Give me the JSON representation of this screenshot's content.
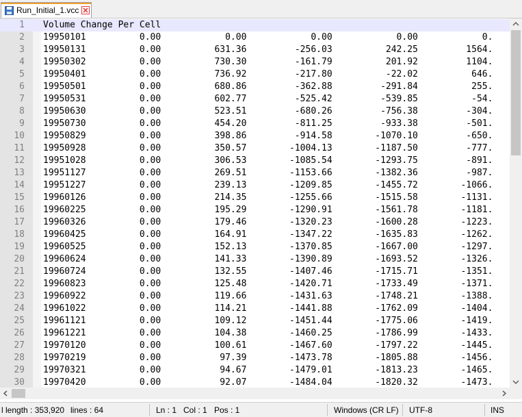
{
  "tab": {
    "title": "Run_Initial_1.vcc"
  },
  "lines": [
    {
      "n": "1",
      "t": "Volume Change Per Cell"
    },
    {
      "n": "2",
      "t": "19950101          0.00            0.00            0.00            0.00            0."
    },
    {
      "n": "3",
      "t": "19950131          0.00          631.36         -256.03          242.25         1564."
    },
    {
      "n": "4",
      "t": "19950302          0.00          730.30         -161.79          201.92         1104."
    },
    {
      "n": "5",
      "t": "19950401          0.00          736.92         -217.80          -22.02          646."
    },
    {
      "n": "6",
      "t": "19950501          0.00          680.86         -362.88         -291.84          255."
    },
    {
      "n": "7",
      "t": "19950531          0.00          602.77         -525.42         -539.85          -54."
    },
    {
      "n": "8",
      "t": "19950630          0.00          523.51         -680.26         -756.38         -304."
    },
    {
      "n": "9",
      "t": "19950730          0.00          454.20         -811.25         -933.38         -501."
    },
    {
      "n": "10",
      "t": "19950829          0.00          398.86         -914.58        -1070.10         -650."
    },
    {
      "n": "11",
      "t": "19950928          0.00          350.57        -1004.13        -1187.50         -777."
    },
    {
      "n": "12",
      "t": "19951028          0.00          306.53        -1085.54        -1293.75         -891."
    },
    {
      "n": "13",
      "t": "19951127          0.00          269.51        -1153.66        -1382.36         -987."
    },
    {
      "n": "14",
      "t": "19951227          0.00          239.13        -1209.85        -1455.72        -1066."
    },
    {
      "n": "15",
      "t": "19960126          0.00          214.35        -1255.66        -1515.58        -1131."
    },
    {
      "n": "16",
      "t": "19960225          0.00          195.29        -1290.91        -1561.78        -1181."
    },
    {
      "n": "17",
      "t": "19960326          0.00          179.46        -1320.23        -1600.28        -1223."
    },
    {
      "n": "18",
      "t": "19960425          0.00          164.91        -1347.22        -1635.83        -1262."
    },
    {
      "n": "19",
      "t": "19960525          0.00          152.13        -1370.85        -1667.00        -1297."
    },
    {
      "n": "20",
      "t": "19960624          0.00          141.33        -1390.89        -1693.52        -1326."
    },
    {
      "n": "21",
      "t": "19960724          0.00          132.55        -1407.46        -1715.71        -1351."
    },
    {
      "n": "22",
      "t": "19960823          0.00          125.48        -1420.71        -1733.49        -1371."
    },
    {
      "n": "23",
      "t": "19960922          0.00          119.66        -1431.63        -1748.21        -1388."
    },
    {
      "n": "24",
      "t": "19961022          0.00          114.21        -1441.88        -1762.09        -1404."
    },
    {
      "n": "25",
      "t": "19961121          0.00          109.12        -1451.44        -1775.06        -1419."
    },
    {
      "n": "26",
      "t": "19961221          0.00          104.38        -1460.25        -1786.99        -1433."
    },
    {
      "n": "27",
      "t": "19970120          0.00          100.61        -1467.60        -1797.22        -1445."
    },
    {
      "n": "28",
      "t": "19970219          0.00           97.39        -1473.78        -1805.88        -1456."
    },
    {
      "n": "29",
      "t": "19970321          0.00           94.67        -1479.01        -1813.23        -1465."
    },
    {
      "n": "30",
      "t": "19970420          0.00           92.07        -1484.04        -1820.32        -1473."
    }
  ],
  "status": {
    "length": "l length : 353,920",
    "lines": "lines : 64",
    "ln": "Ln : 1",
    "col": "Col : 1",
    "pos": "Pos : 1",
    "eol": "Windows (CR LF)",
    "encoding": "UTF-8",
    "mode": "INS"
  },
  "icons": {
    "save": "floppy-disk-icon",
    "close": "close-icon"
  },
  "colors": {
    "current_line": "#e8e8ff",
    "tab_accent": "#f0a030",
    "close_red": "#e04040"
  }
}
